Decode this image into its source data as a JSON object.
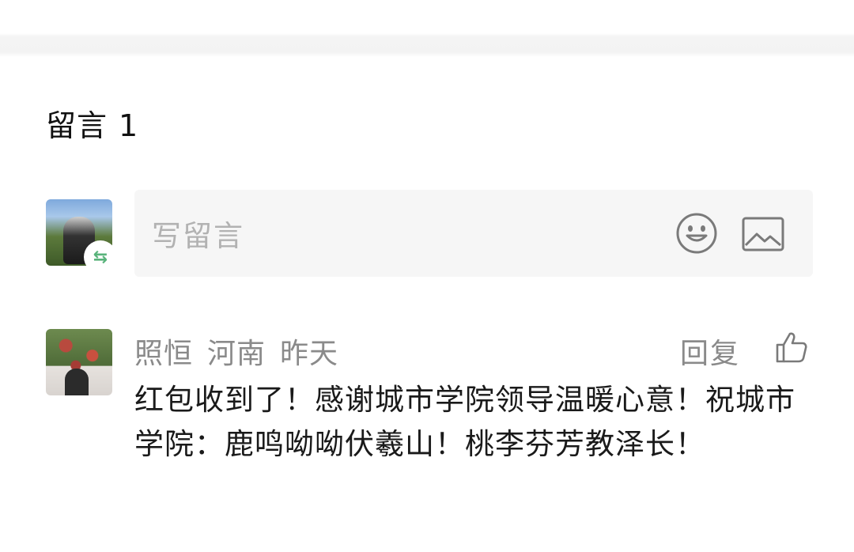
{
  "section": {
    "title": "留言",
    "count": "1"
  },
  "composer": {
    "placeholder": "写留言",
    "avatar_badge_icon": "swap-arrows-icon",
    "emoji_icon": "smiley-face-icon",
    "image_icon": "image-icon",
    "accent_color": "#59b37b"
  },
  "comments": [
    {
      "author": "照恒",
      "location": "河南",
      "time": "昨天",
      "reply_label": "回复",
      "like_icon": "thumbs-up-icon",
      "text": "红包收到了！感谢城市学院领导温暖心意！祝城市学院：鹿鸣呦呦伏羲山！桃李芬芳教泽长！"
    }
  ]
}
